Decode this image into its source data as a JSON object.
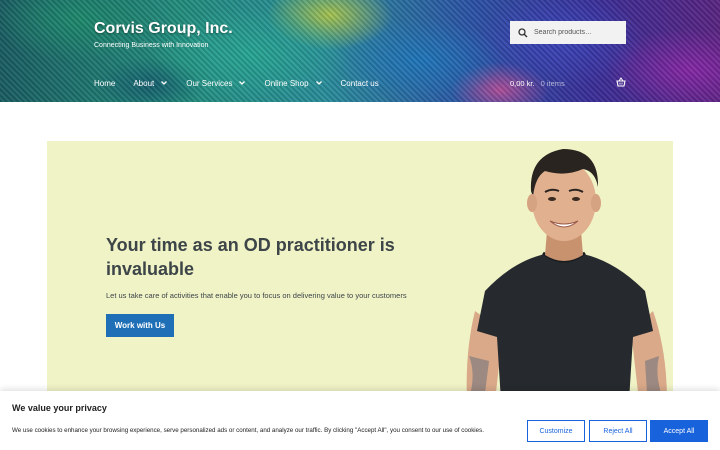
{
  "site": {
    "title": "Corvis Group, Inc.",
    "tagline": "Connecting Business with Innovation"
  },
  "search": {
    "placeholder": "Search products…",
    "icon": "search-icon"
  },
  "nav": {
    "items": [
      {
        "label": "Home",
        "has_dropdown": false
      },
      {
        "label": "About",
        "has_dropdown": true
      },
      {
        "label": "Our Services",
        "has_dropdown": true
      },
      {
        "label": "Online Shop",
        "has_dropdown": true
      },
      {
        "label": "Contact us",
        "has_dropdown": false
      }
    ]
  },
  "cart": {
    "amount": "0,00 kr.",
    "count": "0 items",
    "icon": "basket-icon"
  },
  "hero": {
    "title": "Your time as an OD practitioner is invaluable",
    "text": "Let us take care of activities that enable you to focus on delivering value to your customers",
    "button_label": "Work with Us"
  },
  "cookie": {
    "title": "We value your privacy",
    "text": "We use cookies to enhance your browsing experience, serve personalized ads or content, and analyze our traffic. By clicking \"Accept All\", you consent to our use of cookies.",
    "customize_label": "Customize",
    "reject_label": "Reject All",
    "accept_label": "Accept All"
  },
  "colors": {
    "accent": "#1f6fb7",
    "cookie_accent": "#1863dc",
    "hero_bg": "#f0f3c6",
    "text": "#3d4548"
  }
}
